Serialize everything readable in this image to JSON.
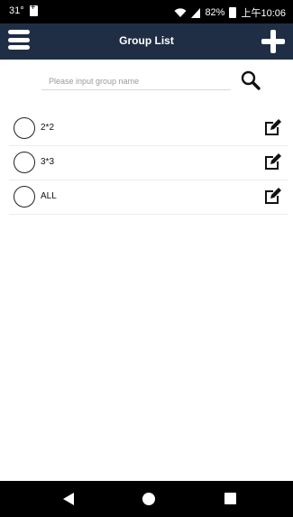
{
  "status_bar": {
    "temperature": "31°",
    "battery_percent": "82%",
    "time": "上午10:06"
  },
  "header": {
    "title": "Group List"
  },
  "search": {
    "placeholder": "Please input group name",
    "value": ""
  },
  "groups": [
    {
      "name": "2*2"
    },
    {
      "name": "3*3"
    },
    {
      "name": "ALL"
    }
  ],
  "colors": {
    "app_bar": "#1f2e45",
    "status_bar": "#000000",
    "nav_bar": "#000000"
  },
  "icons": {
    "menu": "hamburger-menu-icon",
    "add": "plus-icon",
    "search": "magnifier-icon",
    "edit": "pencil-square-icon",
    "back": "triangle-back-icon",
    "home": "circle-home-icon",
    "recent": "square-recent-icon"
  }
}
